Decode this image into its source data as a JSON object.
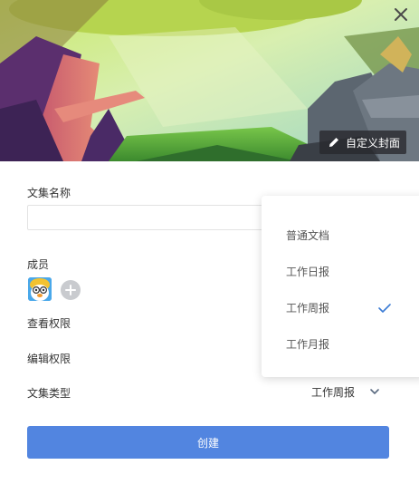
{
  "dialog": {
    "custom_cover_label": "自定义封面",
    "name_label": "文集名称",
    "name_value": "",
    "members_label": "成员",
    "view_permission_label": "查看权限",
    "edit_permission_label": "编辑权限",
    "collection_type_label": "文集类型",
    "collection_type_value": "工作周报",
    "create_button": "创建"
  },
  "type_dropdown": {
    "options": [
      "普通文档",
      "工作日报",
      "工作周报",
      "工作月报"
    ],
    "selected": "工作周报"
  },
  "colors": {
    "primary": "#5285e0",
    "check": "#3a7bd5"
  },
  "icons": {
    "close": "close-icon",
    "edit": "pencil-icon",
    "add_member": "plus-icon",
    "chevron": "chevron-down-icon",
    "check": "check-icon"
  }
}
